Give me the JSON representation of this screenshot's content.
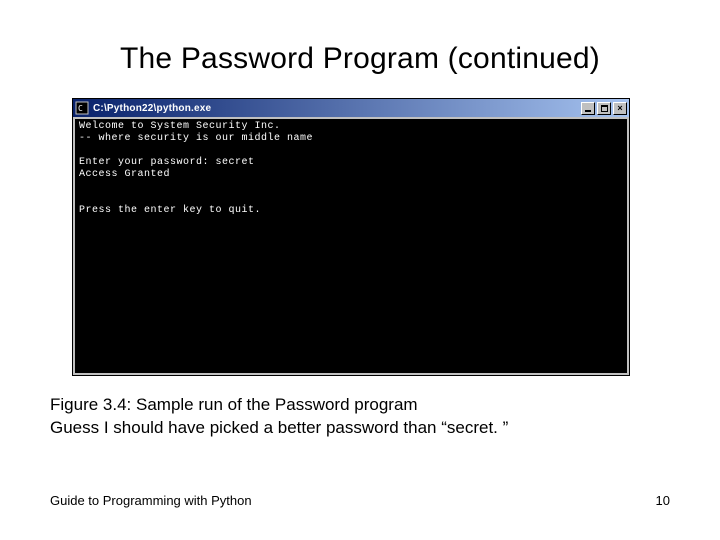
{
  "slide": {
    "title": "The Password Program (continued)",
    "caption_line1": "Figure 3.4: Sample run of the Password program",
    "caption_line2": "Guess I should have picked a better password than “secret. ”",
    "footer_left": "Guide to Programming with Python",
    "page_number": "10"
  },
  "window": {
    "title": "C:\\Python22\\python.exe",
    "icon_name": "command-prompt-icon",
    "buttons": {
      "minimize": "minimize",
      "maximize": "maximize",
      "close": "×"
    }
  },
  "console": {
    "lines": [
      "Welcome to System Security Inc.",
      "-- where security is our middle name",
      "",
      "Enter your password: secret",
      "Access Granted",
      "",
      "",
      "Press the enter key to quit."
    ]
  }
}
